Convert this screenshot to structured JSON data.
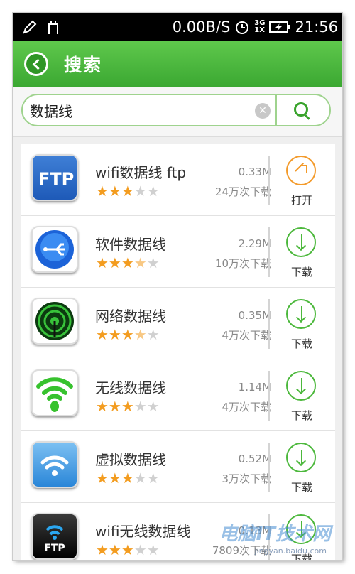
{
  "status_bar": {
    "speed": "0.00B/S",
    "network_top": "3G",
    "network_bottom": "1X",
    "time": "21:56"
  },
  "header": {
    "title": "搜索",
    "back_icon": "back-arrow-icon"
  },
  "search": {
    "query": "数据线",
    "clear_icon": "clear-icon",
    "search_icon": "search-icon"
  },
  "apps": [
    {
      "name": "wifi数据线 ftp",
      "size": "0.33M",
      "downloads": "24万次下载",
      "rating": 3,
      "action": "打开",
      "icon": "ftp-app-icon"
    },
    {
      "name": "软件数据线",
      "size": "2.29M",
      "downloads": "10万次下载",
      "rating": 3.5,
      "action": "下载",
      "icon": "usb-app-icon"
    },
    {
      "name": "网络数据线",
      "size": "0.35M",
      "downloads": "4万次下载",
      "rating": 3.5,
      "action": "下载",
      "icon": "radar-app-icon"
    },
    {
      "name": "无线数据线",
      "size": "1.14M",
      "downloads": "4万次下载",
      "rating": 3,
      "action": "下载",
      "icon": "wifi-app-icon"
    },
    {
      "name": "虚拟数据线",
      "size": "0.52M",
      "downloads": "3万次下载",
      "rating": 3,
      "action": "下载",
      "icon": "wifi-blue-app-icon"
    },
    {
      "name": "wifi无线数据线",
      "size": "0.13M",
      "downloads": "7809次下载",
      "rating": 3,
      "action": "下载",
      "icon": "ftp-wifi-app-icon"
    }
  ],
  "watermark": {
    "text": "电脑IT技术网",
    "url": "jingyan.baidu.com"
  },
  "colors": {
    "brand_green": "#3ba832",
    "star": "#f39c1f",
    "open_orange": "#f39a2a"
  }
}
